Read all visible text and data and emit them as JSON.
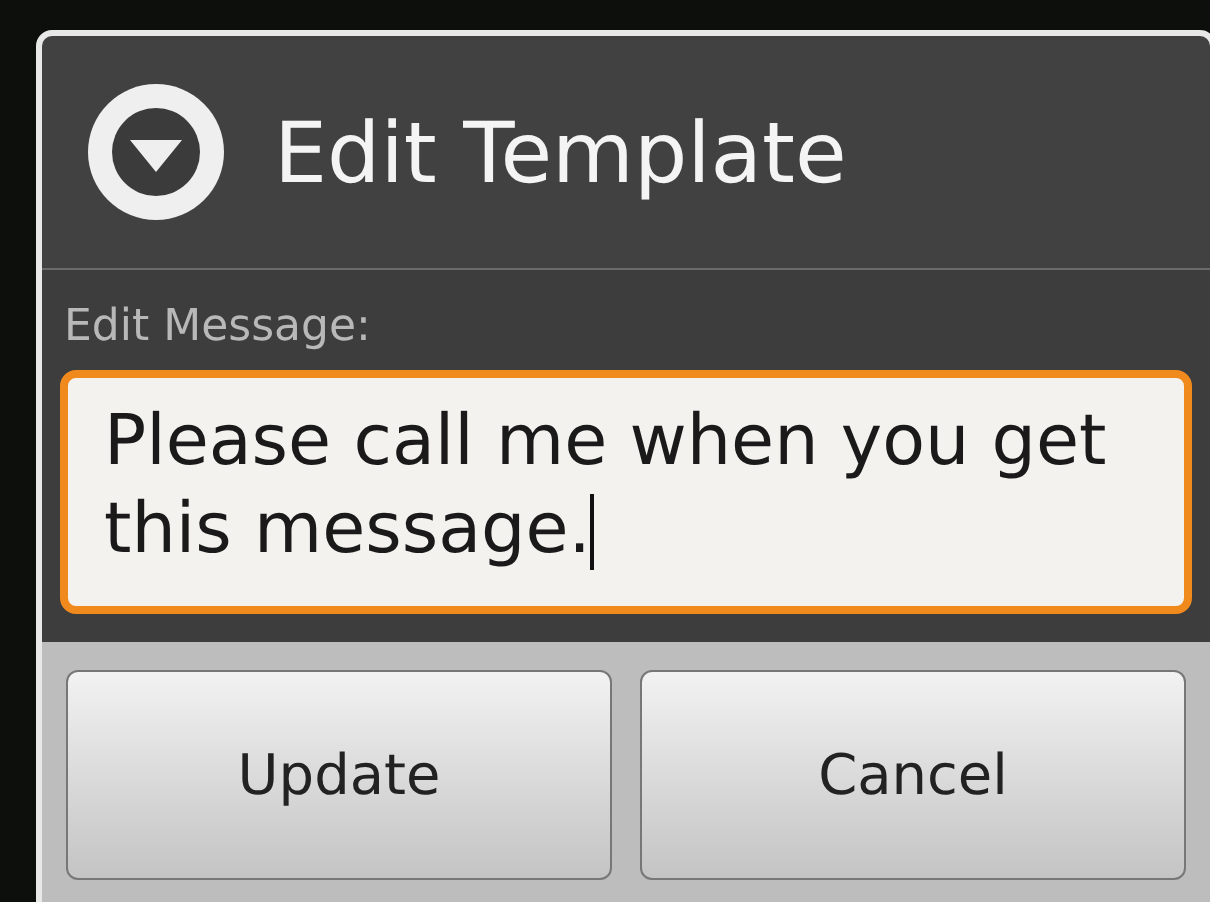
{
  "dialog": {
    "title": "Edit Template",
    "field_label": "Edit Message:",
    "message": {
      "value": "Please call me when you get this message.",
      "focused": true
    },
    "buttons": [
      {
        "label": "Update"
      },
      {
        "label": "Cancel"
      }
    ]
  }
}
